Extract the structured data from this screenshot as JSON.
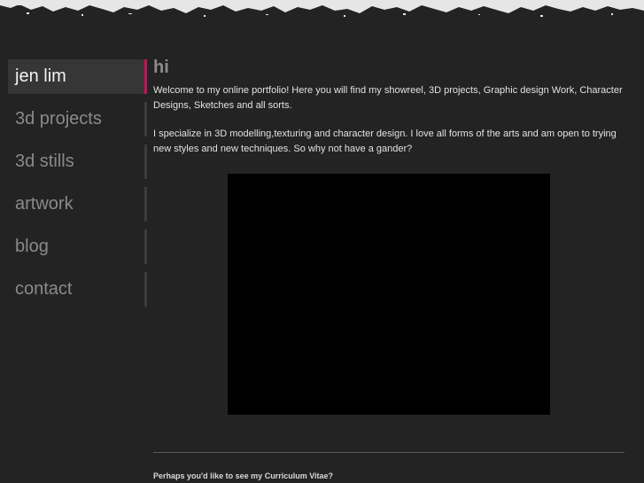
{
  "nav": {
    "items": [
      {
        "label": "jen lim"
      },
      {
        "label": "3d projects"
      },
      {
        "label": "3d stills"
      },
      {
        "label": "artwork"
      },
      {
        "label": "blog"
      },
      {
        "label": "contact"
      }
    ],
    "active_index": 0
  },
  "main": {
    "heading": "hi",
    "paragraph_1": "Welcome to my online portfolio! Here you will find my showreel, 3D projects, Graphic design Work, Character Designs, Sketches and all sorts.",
    "paragraph_2": "I specialize in 3D modelling,texturing and character design. I love all forms of the arts and am open to trying new styles and new techniques. So why not have a gander?",
    "cv_link": "Perhaps you'd like to see my Curriculum Vitae?"
  },
  "colors": {
    "background": "#232323",
    "accent": "#c4135a",
    "nav_text": "#8a8a8a",
    "nav_active_text": "#f2f2f2"
  }
}
